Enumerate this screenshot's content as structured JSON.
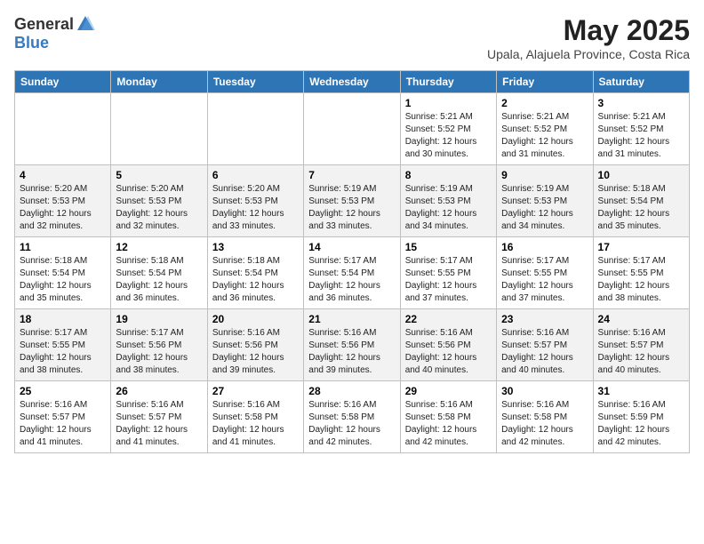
{
  "logo": {
    "general": "General",
    "blue": "Blue"
  },
  "title": "May 2025",
  "location": "Upala, Alajuela Province, Costa Rica",
  "days_of_week": [
    "Sunday",
    "Monday",
    "Tuesday",
    "Wednesday",
    "Thursday",
    "Friday",
    "Saturday"
  ],
  "weeks": [
    [
      {
        "day": "",
        "info": ""
      },
      {
        "day": "",
        "info": ""
      },
      {
        "day": "",
        "info": ""
      },
      {
        "day": "",
        "info": ""
      },
      {
        "day": "1",
        "info": "Sunrise: 5:21 AM\nSunset: 5:52 PM\nDaylight: 12 hours\nand 30 minutes."
      },
      {
        "day": "2",
        "info": "Sunrise: 5:21 AM\nSunset: 5:52 PM\nDaylight: 12 hours\nand 31 minutes."
      },
      {
        "day": "3",
        "info": "Sunrise: 5:21 AM\nSunset: 5:52 PM\nDaylight: 12 hours\nand 31 minutes."
      }
    ],
    [
      {
        "day": "4",
        "info": "Sunrise: 5:20 AM\nSunset: 5:53 PM\nDaylight: 12 hours\nand 32 minutes."
      },
      {
        "day": "5",
        "info": "Sunrise: 5:20 AM\nSunset: 5:53 PM\nDaylight: 12 hours\nand 32 minutes."
      },
      {
        "day": "6",
        "info": "Sunrise: 5:20 AM\nSunset: 5:53 PM\nDaylight: 12 hours\nand 33 minutes."
      },
      {
        "day": "7",
        "info": "Sunrise: 5:19 AM\nSunset: 5:53 PM\nDaylight: 12 hours\nand 33 minutes."
      },
      {
        "day": "8",
        "info": "Sunrise: 5:19 AM\nSunset: 5:53 PM\nDaylight: 12 hours\nand 34 minutes."
      },
      {
        "day": "9",
        "info": "Sunrise: 5:19 AM\nSunset: 5:53 PM\nDaylight: 12 hours\nand 34 minutes."
      },
      {
        "day": "10",
        "info": "Sunrise: 5:18 AM\nSunset: 5:54 PM\nDaylight: 12 hours\nand 35 minutes."
      }
    ],
    [
      {
        "day": "11",
        "info": "Sunrise: 5:18 AM\nSunset: 5:54 PM\nDaylight: 12 hours\nand 35 minutes."
      },
      {
        "day": "12",
        "info": "Sunrise: 5:18 AM\nSunset: 5:54 PM\nDaylight: 12 hours\nand 36 minutes."
      },
      {
        "day": "13",
        "info": "Sunrise: 5:18 AM\nSunset: 5:54 PM\nDaylight: 12 hours\nand 36 minutes."
      },
      {
        "day": "14",
        "info": "Sunrise: 5:17 AM\nSunset: 5:54 PM\nDaylight: 12 hours\nand 36 minutes."
      },
      {
        "day": "15",
        "info": "Sunrise: 5:17 AM\nSunset: 5:55 PM\nDaylight: 12 hours\nand 37 minutes."
      },
      {
        "day": "16",
        "info": "Sunrise: 5:17 AM\nSunset: 5:55 PM\nDaylight: 12 hours\nand 37 minutes."
      },
      {
        "day": "17",
        "info": "Sunrise: 5:17 AM\nSunset: 5:55 PM\nDaylight: 12 hours\nand 38 minutes."
      }
    ],
    [
      {
        "day": "18",
        "info": "Sunrise: 5:17 AM\nSunset: 5:55 PM\nDaylight: 12 hours\nand 38 minutes."
      },
      {
        "day": "19",
        "info": "Sunrise: 5:17 AM\nSunset: 5:56 PM\nDaylight: 12 hours\nand 38 minutes."
      },
      {
        "day": "20",
        "info": "Sunrise: 5:16 AM\nSunset: 5:56 PM\nDaylight: 12 hours\nand 39 minutes."
      },
      {
        "day": "21",
        "info": "Sunrise: 5:16 AM\nSunset: 5:56 PM\nDaylight: 12 hours\nand 39 minutes."
      },
      {
        "day": "22",
        "info": "Sunrise: 5:16 AM\nSunset: 5:56 PM\nDaylight: 12 hours\nand 40 minutes."
      },
      {
        "day": "23",
        "info": "Sunrise: 5:16 AM\nSunset: 5:57 PM\nDaylight: 12 hours\nand 40 minutes."
      },
      {
        "day": "24",
        "info": "Sunrise: 5:16 AM\nSunset: 5:57 PM\nDaylight: 12 hours\nand 40 minutes."
      }
    ],
    [
      {
        "day": "25",
        "info": "Sunrise: 5:16 AM\nSunset: 5:57 PM\nDaylight: 12 hours\nand 41 minutes."
      },
      {
        "day": "26",
        "info": "Sunrise: 5:16 AM\nSunset: 5:57 PM\nDaylight: 12 hours\nand 41 minutes."
      },
      {
        "day": "27",
        "info": "Sunrise: 5:16 AM\nSunset: 5:58 PM\nDaylight: 12 hours\nand 41 minutes."
      },
      {
        "day": "28",
        "info": "Sunrise: 5:16 AM\nSunset: 5:58 PM\nDaylight: 12 hours\nand 42 minutes."
      },
      {
        "day": "29",
        "info": "Sunrise: 5:16 AM\nSunset: 5:58 PM\nDaylight: 12 hours\nand 42 minutes."
      },
      {
        "day": "30",
        "info": "Sunrise: 5:16 AM\nSunset: 5:58 PM\nDaylight: 12 hours\nand 42 minutes."
      },
      {
        "day": "31",
        "info": "Sunrise: 5:16 AM\nSunset: 5:59 PM\nDaylight: 12 hours\nand 42 minutes."
      }
    ]
  ]
}
